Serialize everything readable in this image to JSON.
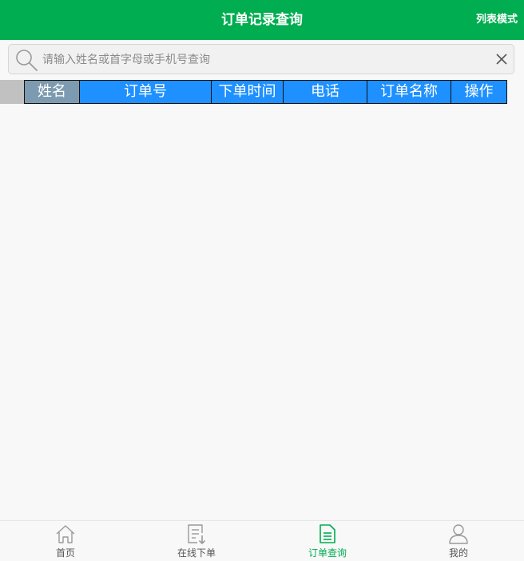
{
  "header": {
    "title": "订单记录查询",
    "mode_label": "列表模式"
  },
  "search": {
    "placeholder": "请输入姓名或首字母或手机号查询",
    "value": ""
  },
  "table": {
    "columns": [
      "姓名",
      "订单号",
      "下单时间",
      "电话",
      "订单名称",
      "操作"
    ]
  },
  "tabbar": {
    "items": [
      {
        "label": "首页",
        "icon": "home-icon"
      },
      {
        "label": "在线下单",
        "icon": "order-form-icon"
      },
      {
        "label": "订单查询",
        "icon": "document-icon"
      },
      {
        "label": "我的",
        "icon": "user-icon"
      }
    ],
    "active": "订单查询"
  },
  "colors": {
    "brand": "#00ad50",
    "header_cell": "#1e90ff",
    "first_header_cell": "#7d9bb0"
  }
}
